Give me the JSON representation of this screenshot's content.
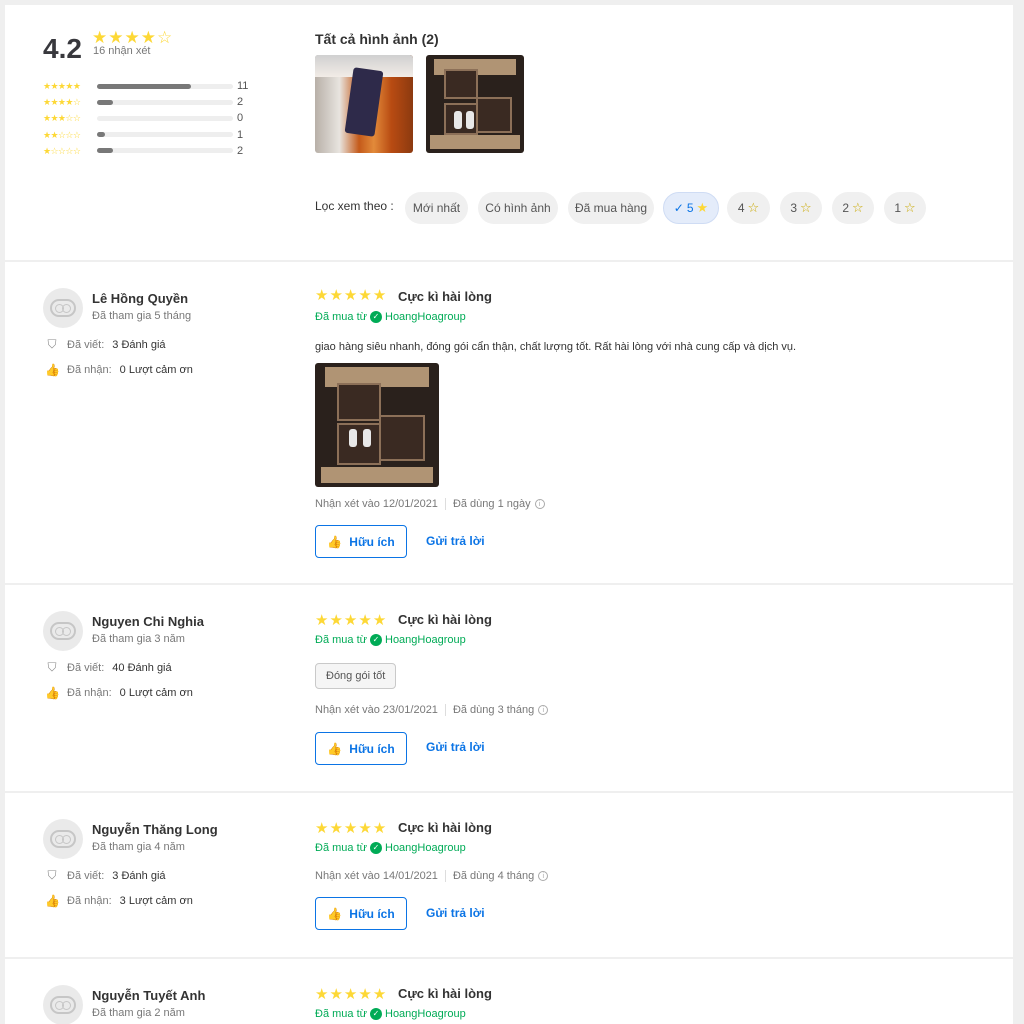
{
  "summary": {
    "score": "4.2",
    "stars": [
      1,
      1,
      1,
      1,
      0
    ],
    "count_text": "16 nhận xét",
    "distribution": [
      {
        "stars": 5,
        "count": "11",
        "fraction": 0.69
      },
      {
        "stars": 4,
        "count": "2",
        "fraction": 0.12
      },
      {
        "stars": 3,
        "count": "0",
        "fraction": 0.0
      },
      {
        "stars": 2,
        "count": "1",
        "fraction": 0.06
      },
      {
        "stars": 1,
        "count": "2",
        "fraction": 0.12
      }
    ],
    "all_images_title": "Tất cả hình ảnh (2)"
  },
  "filter": {
    "label": "Lọc xem theo :",
    "chips": [
      "Mới nhất",
      "Có hình ảnh",
      "Đã mua hàng",
      "5",
      "4",
      "3",
      "2",
      "1"
    ],
    "active": "5"
  },
  "colors": {
    "accent": "#0b74e5",
    "star": "#fdd836",
    "bought": "#00ab56"
  },
  "reviews": [
    {
      "name": "Lê Hồng Quyền",
      "joined": "Đã tham gia 5 tháng",
      "written_label": "Đã viết:",
      "written_value": "3 Đánh giá",
      "thanks_label": "Đã nhận:",
      "thanks_value": "0 Lượt cảm ơn",
      "rating": 5,
      "title": "Cực kì hài lòng",
      "bought_from": "Đã mua từ",
      "seller": "HoangHoagroup",
      "content": "giao hàng siêu nhanh, đóng gói cẩn thận, chất lượng tốt. Rất hài lòng với nhà cung cấp và dịch vụ.",
      "date": "Nhận xét vào 12/01/2021",
      "used": "Đã dùng 1 ngày",
      "useful": "Hữu ích",
      "reply": "Gửi trả lời"
    },
    {
      "name": "Nguyen Chi Nghia",
      "joined": "Đã tham gia 3 năm",
      "written_label": "Đã viết:",
      "written_value": "40 Đánh giá",
      "thanks_label": "Đã nhận:",
      "thanks_value": "0 Lượt cảm ơn",
      "rating": 5,
      "title": "Cực kì hài lòng",
      "bought_from": "Đã mua từ",
      "seller": "HoangHoagroup",
      "tag": "Đóng gói tốt",
      "date": "Nhận xét vào 23/01/2021",
      "used": "Đã dùng 3 tháng",
      "useful": "Hữu ích",
      "reply": "Gửi trả lời"
    },
    {
      "name": "Nguyễn Thăng Long",
      "joined": "Đã tham gia 4 năm",
      "written_label": "Đã viết:",
      "written_value": "3 Đánh giá",
      "thanks_label": "Đã nhận:",
      "thanks_value": "3 Lượt cảm ơn",
      "rating": 5,
      "title": "Cực kì hài lòng",
      "bought_from": "Đã mua từ",
      "seller": "HoangHoagroup",
      "date": "Nhận xét vào 14/01/2021",
      "used": "Đã dùng 4 tháng",
      "useful": "Hữu ích",
      "reply": "Gửi trả lời"
    },
    {
      "name": "Nguyễn Tuyết Anh",
      "joined": "Đã tham gia 2 năm",
      "rating": 5,
      "title": "Cực kì hài lòng",
      "bought_from": "Đã mua từ",
      "seller": "HoangHoagroup"
    }
  ],
  "icons": [
    "star-icon",
    "check-icon",
    "verified-icon",
    "shield-icon",
    "thumbs-up-icon",
    "info-icon",
    "avatar-icon"
  ]
}
